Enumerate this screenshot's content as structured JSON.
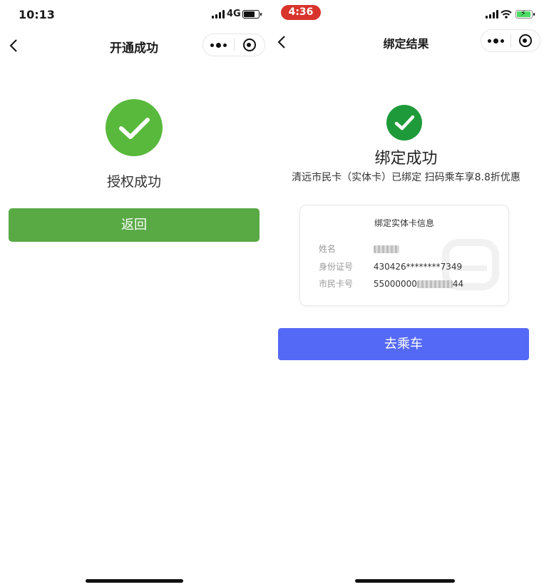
{
  "left_screen": {
    "status": {
      "time": "10:13",
      "network": "4G"
    },
    "nav": {
      "title": "开通成功"
    },
    "success_text": "授权成功",
    "back_button_label": "返回"
  },
  "right_screen": {
    "status": {
      "time": "4:36"
    },
    "nav": {
      "title": "绑定结果"
    },
    "result_title": "绑定成功",
    "result_subtitle": "清远市民卡（实体卡）已绑定 扫码乘车享8.8折优惠",
    "card": {
      "title": "绑定实体卡信息",
      "fields": [
        {
          "label": "姓名",
          "value": ""
        },
        {
          "label": "身份证号",
          "value": "430426********7349"
        },
        {
          "label": "市民卡号",
          "value_prefix": "55000000",
          "value_suffix": "44"
        }
      ]
    },
    "ride_button_label": "去乘车"
  },
  "colors": {
    "success_green": "#58b93c",
    "back_button_green": "#59aa45",
    "dark_green_check": "#1f9a3b",
    "ride_button_blue": "#5569f7",
    "recording_pill_red": "#d8342c"
  },
  "icons": [
    "back-chevron-icon",
    "more-dots-icon",
    "close-target-icon",
    "checkmark-icon",
    "signal-icon",
    "wifi-icon",
    "battery-icon"
  ]
}
